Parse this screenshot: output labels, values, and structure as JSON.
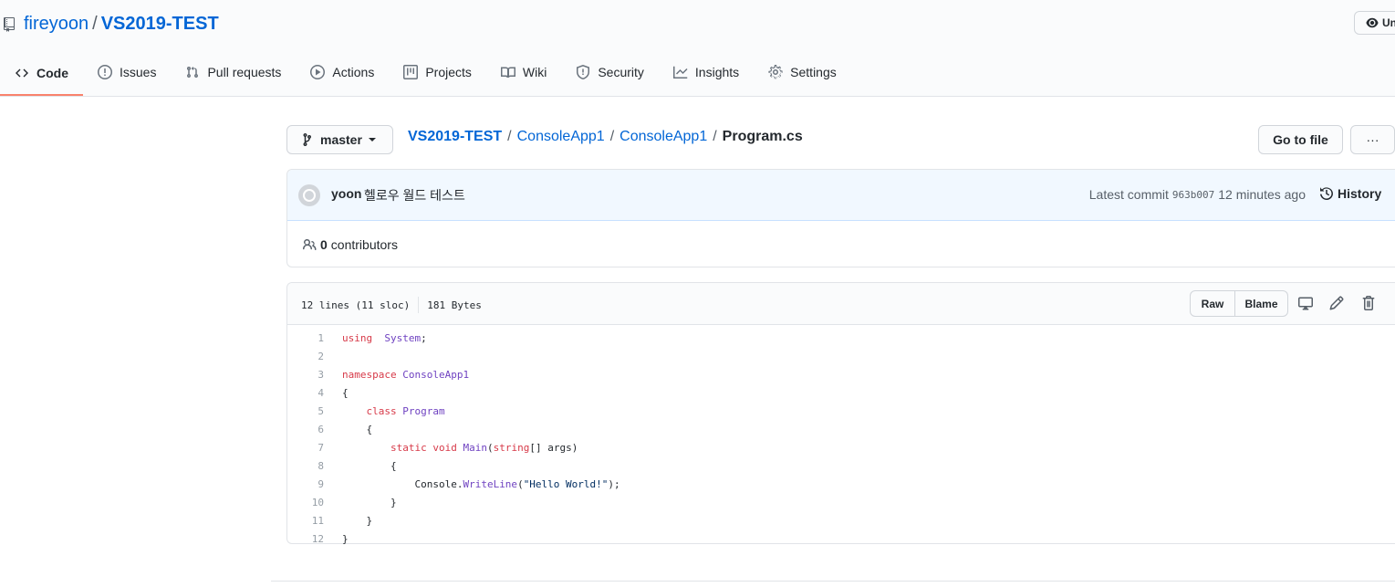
{
  "repo": {
    "owner": "fireyoon",
    "separator": "/",
    "name": "VS2019-TEST",
    "watch_label": "Un"
  },
  "tabs": [
    {
      "label": "Code",
      "icon": "code-icon",
      "active": true
    },
    {
      "label": "Issues",
      "icon": "issue-icon"
    },
    {
      "label": "Pull requests",
      "icon": "pull-request-icon"
    },
    {
      "label": "Actions",
      "icon": "play-icon"
    },
    {
      "label": "Projects",
      "icon": "project-icon"
    },
    {
      "label": "Wiki",
      "icon": "book-icon"
    },
    {
      "label": "Security",
      "icon": "shield-icon"
    },
    {
      "label": "Insights",
      "icon": "graph-icon"
    },
    {
      "label": "Settings",
      "icon": "gear-icon"
    }
  ],
  "branch": {
    "label": "master"
  },
  "breadcrumb": {
    "root": "VS2019-TEST",
    "sep": "/",
    "dir1": "ConsoleApp1",
    "dir2": "ConsoleApp1",
    "file": "Program.cs"
  },
  "actions": {
    "goto_file": "Go to file",
    "more": "···"
  },
  "commit": {
    "author": "yoon",
    "message": "헬로우 월드 테스트",
    "latest_label": "Latest commit",
    "sha": "963b007",
    "time": "12 minutes ago",
    "history_label": "History"
  },
  "contributors": {
    "count": "0",
    "label": "contributors"
  },
  "file": {
    "lines_info": "12 lines (11 sloc)",
    "size": "181 Bytes",
    "raw_label": "Raw",
    "blame_label": "Blame"
  },
  "code_lines": [
    {
      "n": "1",
      "t": [
        [
          "kw",
          "using"
        ],
        [
          "",
          "  "
        ],
        [
          "en",
          "System"
        ],
        [
          "",
          ";"
        ]
      ]
    },
    {
      "n": "2",
      "t": []
    },
    {
      "n": "3",
      "t": [
        [
          "kw",
          "namespace"
        ],
        [
          "",
          " "
        ],
        [
          "en",
          "ConsoleApp1"
        ]
      ]
    },
    {
      "n": "4",
      "t": [
        [
          "",
          "{"
        ]
      ]
    },
    {
      "n": "5",
      "t": [
        [
          "",
          "    "
        ],
        [
          "kw",
          "class"
        ],
        [
          "",
          " "
        ],
        [
          "en",
          "Program"
        ]
      ]
    },
    {
      "n": "6",
      "t": [
        [
          "",
          "    {"
        ]
      ]
    },
    {
      "n": "7",
      "t": [
        [
          "",
          "        "
        ],
        [
          "kw",
          "static"
        ],
        [
          "",
          " "
        ],
        [
          "kw",
          "void"
        ],
        [
          "",
          " "
        ],
        [
          "en",
          "Main"
        ],
        [
          "",
          "("
        ],
        [
          "kw",
          "string"
        ],
        [
          "",
          "[] args)"
        ]
      ]
    },
    {
      "n": "8",
      "t": [
        [
          "",
          "        {"
        ]
      ]
    },
    {
      "n": "9",
      "t": [
        [
          "",
          "            Console."
        ],
        [
          "en",
          "WriteLine"
        ],
        [
          "",
          "("
        ],
        [
          "st",
          "\"Hello World!\""
        ],
        [
          "",
          ");"
        ]
      ]
    },
    {
      "n": "10",
      "t": [
        [
          "",
          "        }"
        ]
      ]
    },
    {
      "n": "11",
      "t": [
        [
          "",
          "    }"
        ]
      ]
    },
    {
      "n": "12",
      "t": [
        [
          "",
          "}"
        ]
      ]
    }
  ],
  "colors": {
    "link": "#0366d6",
    "active_tab_underline": "#f9826c",
    "commit_bg": "#f1f8ff",
    "keyword": "#d73a49",
    "entity": "#6f42c1",
    "string": "#032f62"
  }
}
